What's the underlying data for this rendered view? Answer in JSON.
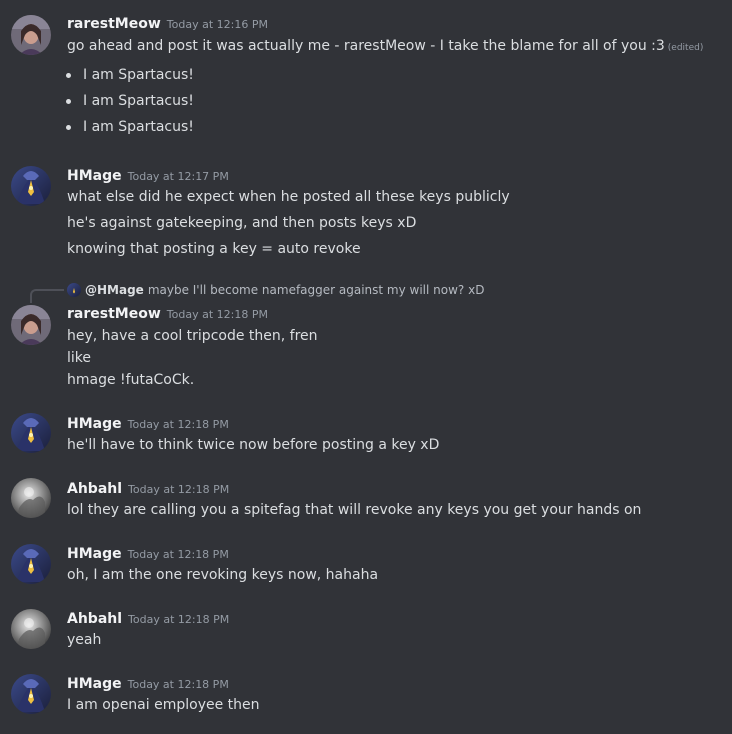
{
  "messages": [
    {
      "author": "rarestMeow",
      "time": "Today at 12:16 PM",
      "avatar": "rarestmeow-avatar",
      "line": "go ahead and post it was actually me - rarestMeow - I take the blame for all of you :3",
      "edited": "(edited)",
      "bullets": [
        "I am Spartacus!",
        "I am Spartacus!",
        "I am Spartacus!"
      ]
    },
    {
      "author": "HMage",
      "time": "Today at 12:17 PM",
      "avatar": "hmage-avatar",
      "lines": [
        "what else did he expect when he posted all these keys publicly",
        "he's against gatekeeping, and then posts keys xD",
        "knowing that posting a key = auto revoke"
      ]
    },
    {
      "author": "rarestMeow",
      "time": "Today at 12:18 PM",
      "avatar": "rarestmeow-avatar",
      "reply": {
        "mention": "@HMage",
        "text": "maybe I'll become namefagger against my will now? xD"
      },
      "lines": [
        "hey, have a cool tripcode then, fren",
        "like",
        "hmage !futaCoCk."
      ]
    },
    {
      "author": "HMage",
      "time": "Today at 12:18 PM",
      "avatar": "hmage-avatar",
      "lines": [
        "he'll have to think twice now before posting a key xD"
      ]
    },
    {
      "author": "Ahbahl",
      "time": "Today at 12:18 PM",
      "avatar": "ahbahl-avatar",
      "lines": [
        "lol they are calling you a spitefag that will revoke any keys you get your hands on"
      ]
    },
    {
      "author": "HMage",
      "time": "Today at 12:18 PM",
      "avatar": "hmage-avatar",
      "lines": [
        "oh, I am the one revoking keys now, hahaha"
      ]
    },
    {
      "author": "Ahbahl",
      "time": "Today at 12:18 PM",
      "avatar": "ahbahl-avatar",
      "lines": [
        "yeah"
      ]
    },
    {
      "author": "HMage",
      "time": "Today at 12:18 PM",
      "avatar": "hmage-avatar",
      "lines": [
        "I am openai employee then"
      ]
    }
  ],
  "colors": {
    "background": "#313338",
    "text": "#dbdee1",
    "username": "#f2f3f5",
    "timestamp": "#949ba4"
  }
}
